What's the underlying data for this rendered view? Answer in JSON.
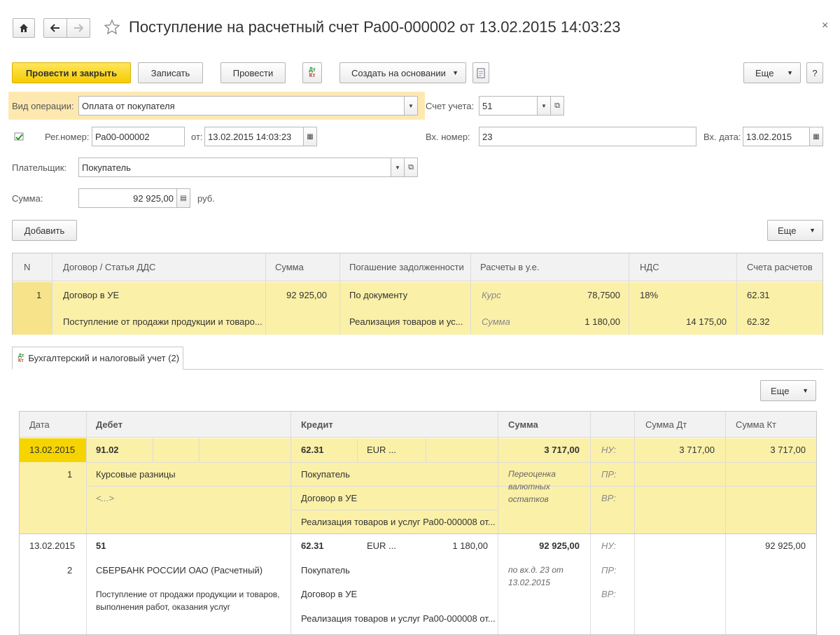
{
  "window": {
    "title": "Поступление на расчетный счет Ра00-000002 от 13.02.2015 14:03:23",
    "close_glyph": "×"
  },
  "toolbar": {
    "post_close": "Провести и закрыть",
    "save": "Записать",
    "post": "Провести",
    "create_based": "Создать на основании",
    "more": "Еще",
    "help": "?",
    "dtkt_icon_text": "Дт\nКт"
  },
  "form": {
    "op_type_label": "Вид операции:",
    "op_type_value": "Оплата от покупателя",
    "account_label": "Счет учета:",
    "account_value": "51",
    "reg_num_label": "Рег.номер:",
    "reg_num_value": "Ра00-000002",
    "from_label": "от:",
    "from_value": "13.02.2015 14:03:23",
    "in_num_label": "Вх. номер:",
    "in_num_value": "23",
    "in_date_label": "Вх. дата:",
    "in_date_value": "13.02.2015",
    "payer_label": "Плательщик:",
    "payer_value": "Покупатель",
    "sum_label": "Сумма:",
    "sum_value": "92 925,00",
    "currency": "руб."
  },
  "table_toolbar": {
    "add": "Добавить",
    "more": "Еще"
  },
  "table": {
    "headers": [
      "N",
      "Договор / Статья ДДС",
      "Сумма",
      "Погашение задолженности",
      "Расчеты в у.е.",
      "НДС",
      "Счета расчетов"
    ],
    "row": {
      "n": "1",
      "contract": "Договор в УЕ",
      "article": "Поступление от продажи продукции и товаро...",
      "sum": "92 925,00",
      "repay1": "По документу",
      "repay2": "Реализация товаров и ус...",
      "rate_label": "Курс",
      "rate_value": "78,7500",
      "sum_label": "Сумма",
      "sum_value": "1 180,00",
      "vat": "18%",
      "vat_sum": "14 175,00",
      "acc1": "62.31",
      "acc2": "62.32"
    }
  },
  "tab": {
    "label": "Бухгалтерский и налоговый учет (2)",
    "more": "Еще"
  },
  "ledger": {
    "headers": [
      "Дата",
      "Дебет",
      "Кредит",
      "Сумма",
      "Сумма Дт",
      "Сумма Кт"
    ],
    "rows": [
      {
        "date": "13.02.2015",
        "n": "1",
        "debit": "91.02",
        "debit_sub1": "Курсовые разницы",
        "debit_sub2": "<...>",
        "credit": "62.31",
        "credit_cur": "EUR ...",
        "credit_amount": "",
        "credit_sub1": "Покупатель",
        "credit_sub2": "Договор в УЕ",
        "credit_sub3": "Реализация товаров и услуг Ра00-000008 от...",
        "sum": "3 717,00",
        "comment": "Переоценка валютных остатков",
        "nu": "НУ:",
        "pr": "ПР:",
        "vr": "ВР:",
        "sum_dt": "3 717,00",
        "sum_kt": "3 717,00"
      },
      {
        "date": "13.02.2015",
        "n": "2",
        "debit": "51",
        "debit_sub1": "СБЕРБАНК РОССИИ ОАО (Расчетный)",
        "debit_sub2": "Поступление от продажи продукции и товаров, выполнения работ, оказания услуг",
        "credit": "62.31",
        "credit_cur": "EUR ...",
        "credit_amount": "1 180,00",
        "credit_sub1": "Покупатель",
        "credit_sub2": "Договор в УЕ",
        "credit_sub3": "Реализация товаров и услуг Ра00-000008 от...",
        "sum": "92 925,00",
        "comment": "по вх.д. 23 от 13.02.2015",
        "nu": "НУ:",
        "pr": "ПР:",
        "vr": "ВР:",
        "sum_dt": "",
        "sum_kt": "92 925,00"
      }
    ]
  },
  "colors": {
    "highlight": "#fbf0a8",
    "selected": "#f5d400",
    "primary": "#f5cc00"
  }
}
